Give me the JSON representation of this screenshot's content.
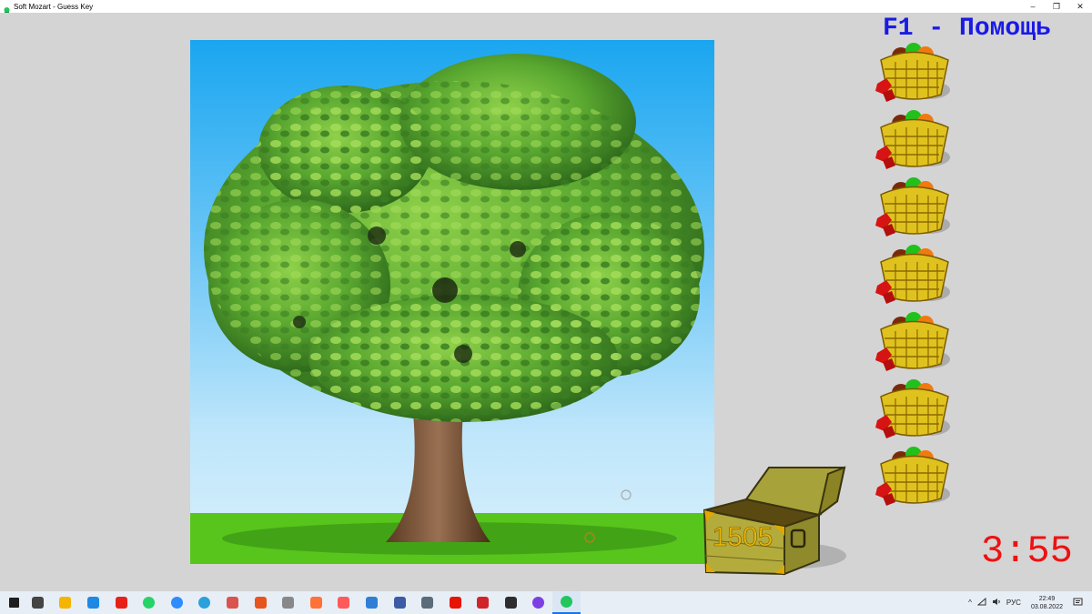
{
  "window": {
    "title": "Soft Mozart - Guess Key",
    "controls": [
      "–",
      "❐",
      "✕"
    ]
  },
  "game": {
    "help_text": "F1 - Помощь",
    "score": "1505",
    "timer": "3:55",
    "baskets_count": 7
  },
  "taskbar": {
    "icons": [
      {
        "name": "start-icon",
        "color": "#1f1f1f"
      },
      {
        "name": "task-view-icon",
        "color": "#444444"
      },
      {
        "name": "file-explorer-icon",
        "color": "#f5b400"
      },
      {
        "name": "edge-icon",
        "color": "#1e88e5"
      },
      {
        "name": "youtube-icon",
        "color": "#e62117"
      },
      {
        "name": "whatsapp-icon",
        "color": "#25d366"
      },
      {
        "name": "zoom-icon",
        "color": "#2d8cff"
      },
      {
        "name": "telegram-icon",
        "color": "#2aa1da"
      },
      {
        "name": "app-icon-1",
        "color": "#d9534f"
      },
      {
        "name": "headphones-icon",
        "color": "#e8541e"
      },
      {
        "name": "mu-icon",
        "color": "#888888"
      },
      {
        "name": "firefox-icon",
        "color": "#ff7139"
      },
      {
        "name": "paint-icon",
        "color": "#ff5a5a"
      },
      {
        "name": "app-icon-2",
        "color": "#2f7fd6"
      },
      {
        "name": "save-icon",
        "color": "#3b5ba5"
      },
      {
        "name": "camera-icon",
        "color": "#5a6b7a"
      },
      {
        "name": "yandex-icon",
        "color": "#e61400"
      },
      {
        "name": "arrow-app-icon",
        "color": "#d2232a"
      },
      {
        "name": "obs-icon",
        "color": "#2d2d2d"
      },
      {
        "name": "circle-app-icon",
        "color": "#7b3fe4"
      },
      {
        "name": "soft-mozart-icon",
        "color": "#22c55e"
      }
    ],
    "tray": {
      "chevron": "^",
      "lang": "РУС",
      "time": "22:49",
      "date": "03.08.2022"
    }
  }
}
